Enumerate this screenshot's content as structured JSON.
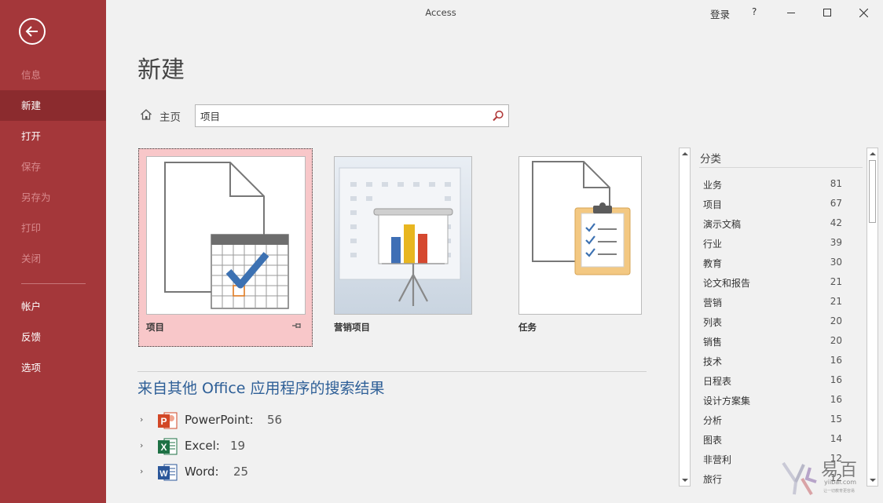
{
  "window": {
    "title": "Access",
    "sign_in": "登录",
    "help": "?"
  },
  "sidebar": {
    "items": [
      {
        "label": "信息",
        "state": "disabled"
      },
      {
        "label": "新建",
        "state": "active"
      },
      {
        "label": "打开",
        "state": "normal"
      },
      {
        "label": "保存",
        "state": "disabled"
      },
      {
        "label": "另存为",
        "state": "disabled"
      },
      {
        "label": "打印",
        "state": "disabled"
      },
      {
        "label": "关闭",
        "state": "disabled"
      },
      {
        "label": "帐户",
        "state": "normal"
      },
      {
        "label": "反馈",
        "state": "normal"
      },
      {
        "label": "选项",
        "state": "normal"
      }
    ]
  },
  "main": {
    "title": "新建",
    "home_label": "主页",
    "search": {
      "value": "项目",
      "placeholder": ""
    },
    "templates": [
      {
        "label": "项目",
        "icon": "calendar-check-icon",
        "selected": true
      },
      {
        "label": "营销项目",
        "icon": "presentation-chart-icon",
        "selected": false
      },
      {
        "label": "任务",
        "icon": "clipboard-checklist-icon",
        "selected": false
      }
    ],
    "results_heading": "来自其他 Office 应用程序的搜索结果",
    "results": [
      {
        "app": "PowerPoint:",
        "count": "56",
        "icon": "powerpoint-icon",
        "color": "#d24726"
      },
      {
        "app": "Excel:",
        "count": "19",
        "icon": "excel-icon",
        "color": "#1e7145"
      },
      {
        "app": "Word:",
        "count": "25",
        "icon": "word-icon",
        "color": "#2b579a"
      }
    ]
  },
  "categories": {
    "heading": "分类",
    "items": [
      {
        "name": "业务",
        "count": "81"
      },
      {
        "name": "项目",
        "count": "67"
      },
      {
        "name": "演示文稿",
        "count": "42"
      },
      {
        "name": "行业",
        "count": "39"
      },
      {
        "name": "教育",
        "count": "30"
      },
      {
        "name": "论文和报告",
        "count": "21"
      },
      {
        "name": "营销",
        "count": "21"
      },
      {
        "name": "列表",
        "count": "20"
      },
      {
        "name": "销售",
        "count": "20"
      },
      {
        "name": "技术",
        "count": "16"
      },
      {
        "name": "日程表",
        "count": "16"
      },
      {
        "name": "设计方案集",
        "count": "16"
      },
      {
        "name": "分析",
        "count": "15"
      },
      {
        "name": "图表",
        "count": "14"
      },
      {
        "name": "非营利",
        "count": "12"
      },
      {
        "name": "旅行",
        "count": "12"
      }
    ]
  },
  "watermark": {
    "text": "易百",
    "url": "yiibai.com",
    "slogan": "让一切教育更容易"
  },
  "colors": {
    "sidebar": "#a4373a",
    "sidebar_active": "#8b2b2e",
    "accent_blue": "#2e5f97",
    "selected_card": "#f8c7c9"
  }
}
